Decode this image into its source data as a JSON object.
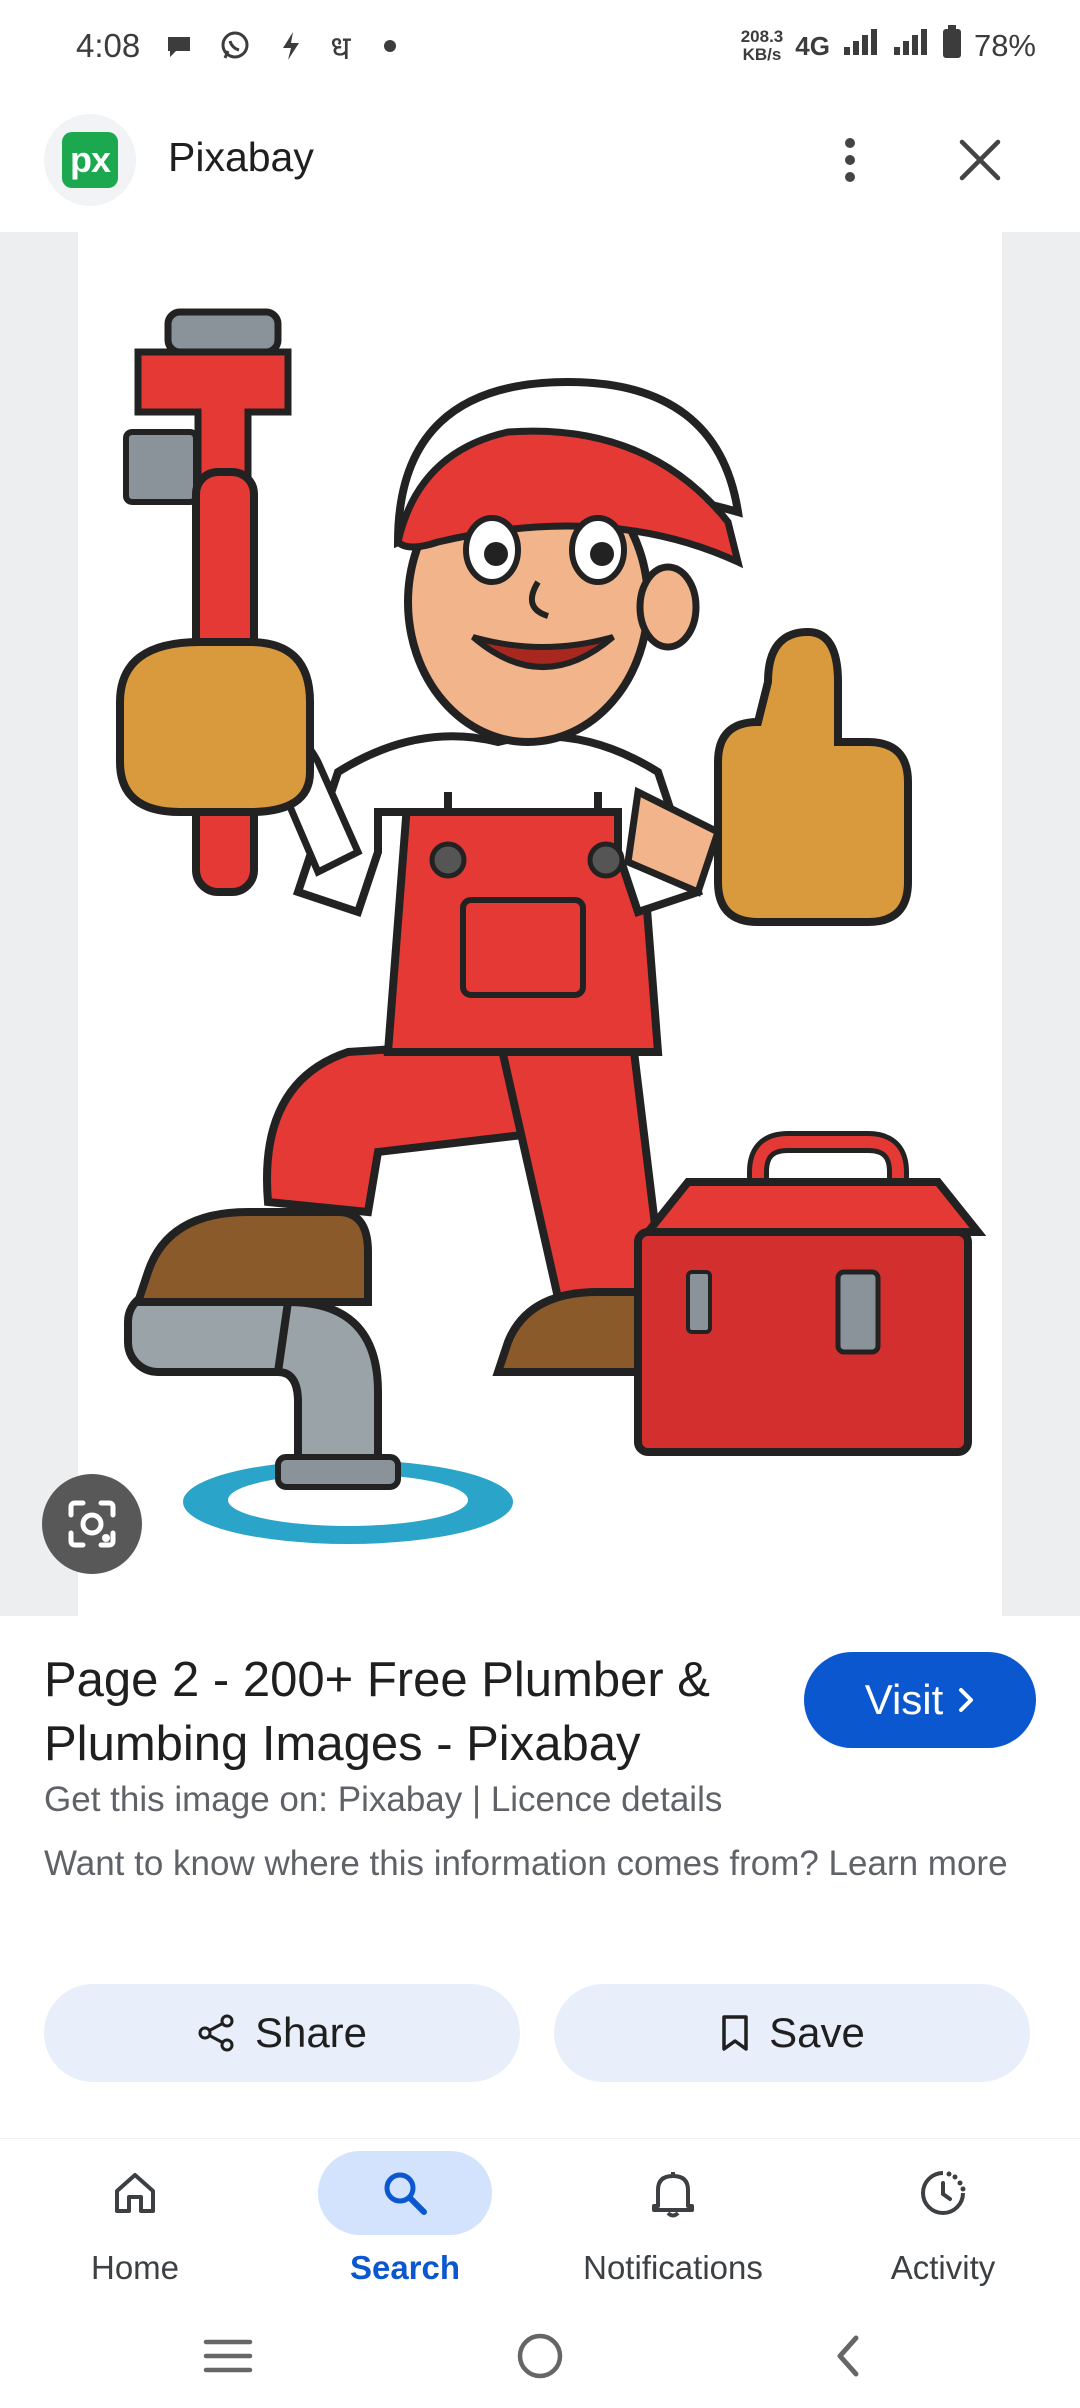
{
  "status_bar": {
    "time": "4:08",
    "extra_glyph": "ध",
    "speed_top": "208.3",
    "speed_bottom": "KB/s",
    "network": "4G",
    "battery": "78%"
  },
  "header": {
    "logo_text": "px",
    "site_name": "Pixabay"
  },
  "image": {
    "description_icon": "plumber-illustration"
  },
  "result": {
    "title": "Page 2 - 200+ Free Plumber & Plumbing Images - Pixabay",
    "visit_label": "Visit",
    "source": "Get this image on: Pixabay | Licence details",
    "note": "Want to know where this information comes from? Learn more",
    "share_label": "Share",
    "save_label": "Save"
  },
  "bottom_nav": {
    "items": [
      {
        "label": "Home",
        "icon": "home-icon",
        "active": false
      },
      {
        "label": "Search",
        "icon": "search-icon",
        "active": true
      },
      {
        "label": "Notifications",
        "icon": "bell-icon",
        "active": false
      },
      {
        "label": "Activity",
        "icon": "activity-icon",
        "active": false
      }
    ]
  },
  "colors": {
    "accent": "#0b57d0",
    "accent_soft": "#d3e3fd",
    "chip_bg": "#e8effa",
    "pixabay_green": "#1ca84f"
  }
}
